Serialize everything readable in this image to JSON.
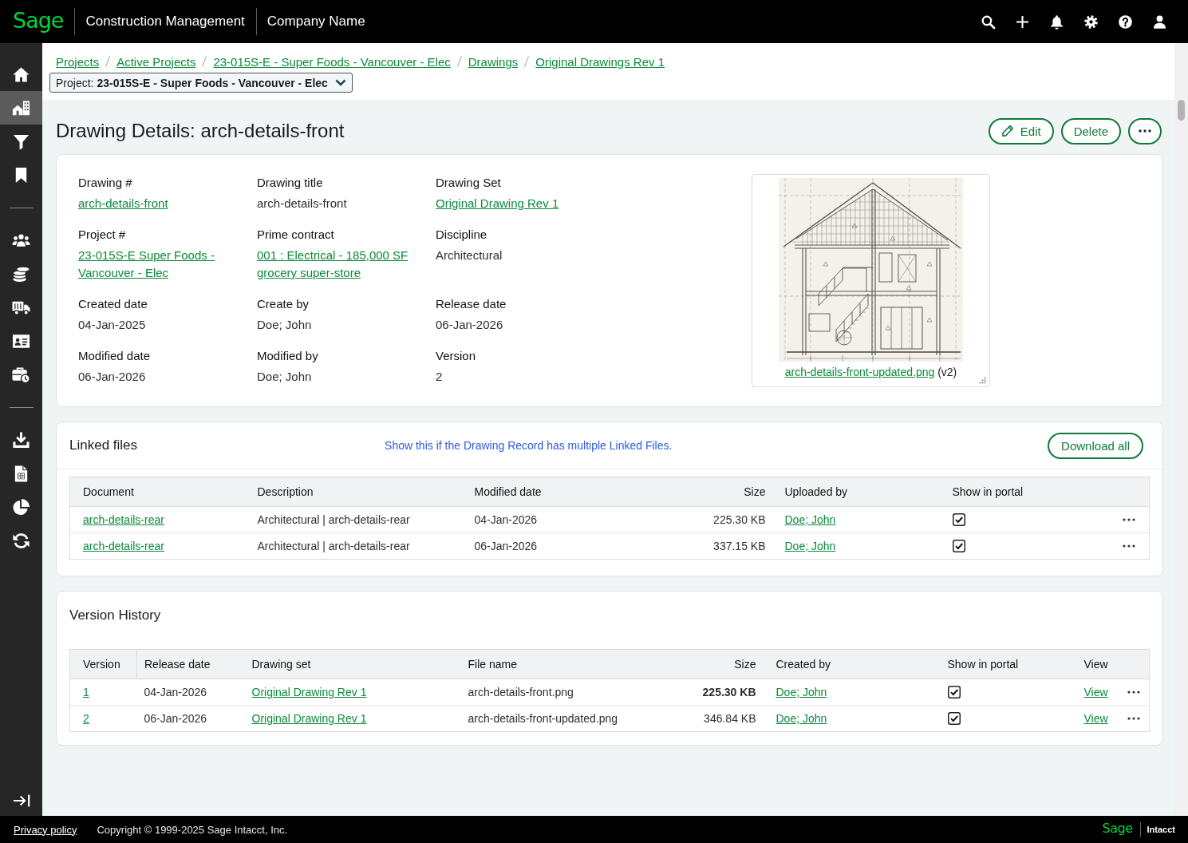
{
  "top_bar": {
    "logo": "Sage",
    "app_name": "Construction Management",
    "company_name": "Company Name"
  },
  "sidebar": {
    "groups": [
      {
        "items": [
          {
            "selected": false
          },
          {
            "selected": true
          },
          {
            "selected": false
          },
          {
            "selected": false
          }
        ]
      },
      {
        "items": [
          {
            "selected": false
          },
          {
            "selected": false
          },
          {
            "selected": false
          },
          {
            "selected": false
          },
          {
            "selected": false
          }
        ]
      },
      {
        "items": [
          {
            "selected": false
          },
          {
            "selected": false
          },
          {
            "selected": false
          },
          {
            "selected": false
          }
        ]
      }
    ]
  },
  "breadcrumbs": [
    "Projects",
    "Active Projects",
    "23-015S-E - Super Foods - Vancouver - Elec",
    "Drawings",
    "Original Drawings Rev 1"
  ],
  "project_selector": {
    "label": "Project:",
    "value": "23-015S-E - Super Foods - Vancouver - Elec"
  },
  "page_title": "Drawing Details: arch-details-front",
  "actions": [
    {
      "kind": "edit",
      "label": "Edit"
    },
    {
      "kind": "plain",
      "label": "Delete"
    },
    {
      "kind": "more"
    }
  ],
  "details": {
    "fields": [
      {
        "label": "Drawing #",
        "value": "arch-details-front",
        "link": true
      },
      {
        "label": "Drawing title",
        "value": "arch-details-front",
        "link": false
      },
      {
        "label": "Drawing Set",
        "value": "Original Drawing Rev 1",
        "link": true
      },
      {
        "label": "Project #",
        "value": "23-015S-E Super Foods - Vancouver - Elec",
        "link": true
      },
      {
        "label": "Prime contract",
        "value": "001 : Electrical - 185,000 SF grocery super-store",
        "link": true
      },
      {
        "label": "Discipline",
        "value": "Architectural",
        "link": false
      },
      {
        "label": "Created date",
        "value": "04-Jan-2025",
        "link": false
      },
      {
        "label": "Create by",
        "value": "Doe; John",
        "link": false
      },
      {
        "label": "Release date",
        "value": "06-Jan-2026",
        "link": false
      },
      {
        "label": "Modified date",
        "value": "06-Jan-2026",
        "link": false
      },
      {
        "label": "Modified by",
        "value": "Doe; John",
        "link": false
      },
      {
        "label": "Version",
        "value": "2",
        "link": false
      }
    ],
    "preview": {
      "file_name": "arch-details-front-updated.png",
      "version": "(v2)"
    }
  },
  "linked_files": {
    "title": "Linked files",
    "note": "Show this if the Drawing Record has multiple Linked Files.",
    "download_button": "Download all",
    "columns": [
      "Document",
      "Description",
      "Modified date",
      "Size",
      "Uploaded by",
      "Show in portal"
    ],
    "rows": [
      {
        "document": "arch-details-rear",
        "description": "Architectural | arch-details-rear",
        "modified_date": "04-Jan-2026",
        "size": "225.30 KB",
        "uploaded_by": "Doe; John",
        "show_in_portal": true
      },
      {
        "document": "arch-details-rear",
        "description": "Architectural | arch-details-rear",
        "modified_date": "06-Jan-2026",
        "size": "337.15 KB",
        "uploaded_by": "Doe; John",
        "show_in_portal": true
      }
    ]
  },
  "version_history": {
    "title": "Version History",
    "columns": [
      "Version",
      "Release date",
      "Drawing set",
      "File name",
      "Size",
      "Created by",
      "Show in portal",
      "View"
    ],
    "rows": [
      {
        "version": "1",
        "release_date": "04-Jan-2026",
        "drawing_set": "Original Drawing Rev 1",
        "file_name": "arch-details-front.png",
        "size": "225.30 KB",
        "size_bold": true,
        "created_by": "Doe; John",
        "show_in_portal": true,
        "view": "View"
      },
      {
        "version": "2",
        "release_date": "06-Jan-2026",
        "drawing_set": "Original Drawing Rev 1",
        "file_name": "arch-details-front-updated.png",
        "size": "346.84 KB",
        "size_bold": false,
        "created_by": "Doe; John",
        "show_in_portal": true,
        "view": "View"
      }
    ]
  },
  "footer": {
    "privacy_link": "Privacy policy",
    "copyright": "Copyright © 1999-2025 Sage Intacct, Inc.",
    "logo": "Sage",
    "product": "Intacct"
  }
}
